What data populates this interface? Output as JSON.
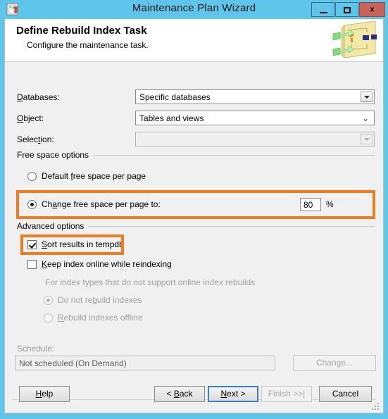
{
  "window": {
    "title": "Maintenance Plan Wizard",
    "app_icon": "maintenance-plan-icon",
    "minimize_label": "",
    "maximize_label": "",
    "close_label": "x",
    "frame_color": "#5fc5ea",
    "close_color": "#c9625b"
  },
  "header": {
    "title": "Define Rebuild Index Task",
    "subtitle": "Configure the maintenance task.",
    "art_icon": "maintenance-plan-diagram-icon"
  },
  "form": {
    "databases": {
      "label": "Databases:",
      "accelerator": "D",
      "value": "Specific databases",
      "enabled": true,
      "arrow_style": "boxed-triangle"
    },
    "object": {
      "label": "Object:",
      "accelerator": "O",
      "value": "Tables and views",
      "enabled": true,
      "arrow_style": "chevron"
    },
    "selection": {
      "label": "Selection:",
      "accelerator": "t",
      "value": "",
      "enabled": false,
      "arrow_style": "boxed-triangle-disabled"
    }
  },
  "free_space": {
    "caption": "Free space options",
    "options": [
      {
        "label": "Default free space per page",
        "accelerator": "f",
        "checked": false,
        "enabled": true
      },
      {
        "label": "Change free space per page to:",
        "accelerator": "a",
        "checked": true,
        "enabled": true
      }
    ],
    "value": "80",
    "unit": "%",
    "highlighted": true
  },
  "advanced": {
    "caption": "Advanced options",
    "sort_tempdb": {
      "label": "Sort results in tempdb",
      "accelerator": "S",
      "checked": true,
      "enabled": true,
      "highlighted": true
    },
    "keep_online": {
      "label": "Keep index online while reindexing",
      "accelerator": "K",
      "checked": false,
      "enabled": true
    },
    "sub_note": "For index types that do not support online index rebuilds",
    "sub_options": [
      {
        "label": "Do not rebuild indexes",
        "accelerator": "b",
        "checked": true,
        "enabled": false
      },
      {
        "label": "Rebuild indexes offline",
        "accelerator": "R",
        "checked": false,
        "enabled": false
      }
    ]
  },
  "schedule": {
    "label": "Schedule:",
    "value": "Not scheduled (On Demand)",
    "change_button": "Change...",
    "change_accelerator": "C",
    "enabled": false
  },
  "footer": {
    "help": "Help",
    "help_accelerator": "H",
    "back": "< Back",
    "back_accelerator": "B",
    "next": "Next >",
    "next_accelerator": "N",
    "finish": "Finish >>|",
    "finish_accelerator": "F",
    "cancel": "Cancel",
    "next_focused": true,
    "finish_enabled": false
  },
  "colors": {
    "highlight": "#ED7D20",
    "titlebar": "#5fc5ea",
    "dialog_bg": "#f0f0f0",
    "focus_border": "#3a7fc1"
  }
}
